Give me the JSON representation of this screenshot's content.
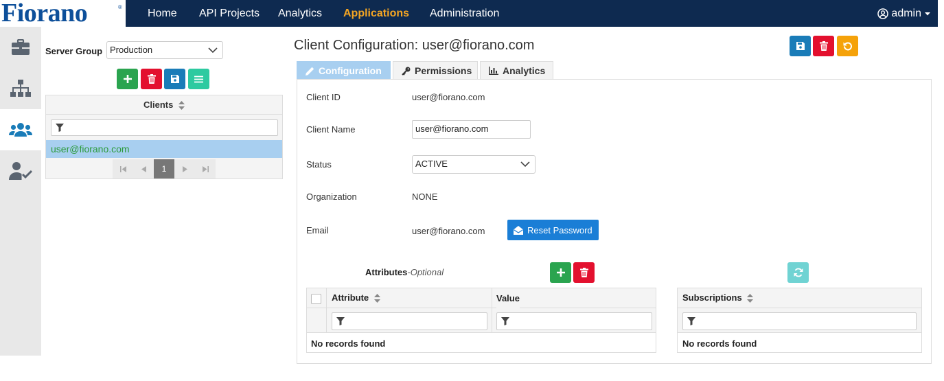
{
  "nav": {
    "logo": "Fiorano",
    "logo_reg": "®",
    "items": [
      {
        "label": "Home"
      },
      {
        "label": "API Projects"
      },
      {
        "label": "Analytics"
      },
      {
        "label": "Applications"
      },
      {
        "label": "Administration"
      }
    ],
    "active": "Applications",
    "user": "admin"
  },
  "sidebar": {
    "icons": [
      "briefcase-icon",
      "sitemap-icon",
      "users-icon",
      "user-check-icon"
    ],
    "active": "users-icon"
  },
  "left": {
    "server_group_label": "Server Group",
    "server_group_value": "Production",
    "clients_header": "Clients",
    "clients": [
      "user@fiorano.com"
    ],
    "page": "1"
  },
  "main": {
    "title": "Client Configuration: user@fiorano.com",
    "tabs": [
      {
        "label": "Configuration",
        "icon": "pencil-icon"
      },
      {
        "label": "Permissions",
        "icon": "key-icon"
      },
      {
        "label": "Analytics",
        "icon": "bar-chart-icon"
      }
    ],
    "active_tab": "Configuration",
    "fields": {
      "client_id_label": "Client ID",
      "client_id": "user@fiorano.com",
      "client_name_label": "Client Name",
      "client_name": "user@fiorano.com",
      "status_label": "Status",
      "status": "ACTIVE",
      "organization_label": "Organization",
      "organization": "NONE",
      "email_label": "Email",
      "email": "user@fiorano.com",
      "reset_password": "Reset Password"
    },
    "attributes": {
      "title": "Attributes",
      "suffix": "-Optional",
      "col_attribute": "Attribute",
      "col_value": "Value",
      "empty": "No records found"
    },
    "subscriptions": {
      "col": "Subscriptions",
      "empty": "No records found"
    }
  },
  "colors": {
    "navbar": "#0e2a50",
    "active_nav": "#f5a623",
    "green": "#2aa44f",
    "red": "#e3102e",
    "blue": "#1a7cb8",
    "orange": "#f5a20a",
    "selection": "#a8cff0"
  }
}
